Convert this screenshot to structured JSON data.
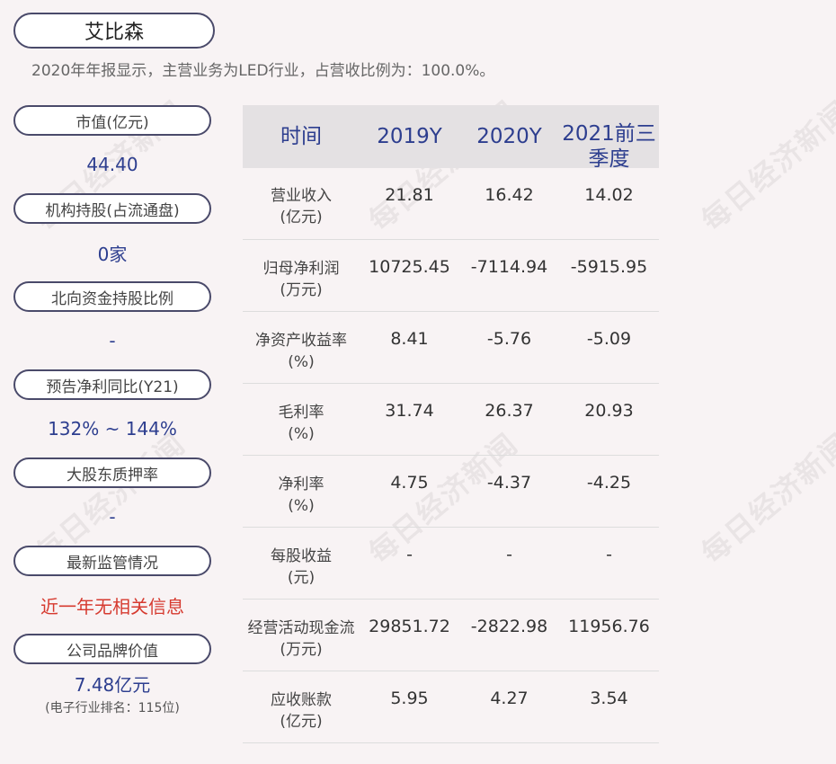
{
  "company": {
    "name": "艾比森"
  },
  "summary": "2020年年报显示，主营业务为LED行业，占营收比例为：100.0%。",
  "watermark": "每日经济新闻",
  "metrics": [
    {
      "label": "市值(亿元)",
      "value": "44.40"
    },
    {
      "label": "机构持股(占流通盘)",
      "value": "0家"
    },
    {
      "label": "北向资金持股比例",
      "value": "-"
    },
    {
      "label": "预告净利同比(Y21)",
      "value": "132% ~ 144%"
    },
    {
      "label": "大股东质押率",
      "value": "-"
    },
    {
      "label": "最新监管情况",
      "value": "近一年无相关信息",
      "color": "#d63a2f"
    },
    {
      "label": "公司品牌价值",
      "value": "7.48亿元",
      "note": "(电子行业排名：115位)"
    }
  ],
  "table": {
    "headers": [
      "时间",
      "2019Y",
      "2020Y",
      "2021前三季度"
    ],
    "rows": [
      {
        "label": "营业收入(亿元)",
        "label_lines": [
          "营业收入",
          "(亿元)"
        ],
        "values": [
          "21.81",
          "16.42",
          "14.02"
        ]
      },
      {
        "label": "归母净利润(万元)",
        "label_lines": [
          "归母净利润",
          "(万元)"
        ],
        "values": [
          "10725.45",
          "-7114.94",
          "-5915.95"
        ]
      },
      {
        "label": "净资产收益率(%)",
        "label_lines": [
          "净资产收益率",
          "(%)"
        ],
        "values": [
          "8.41",
          "-5.76",
          "-5.09"
        ]
      },
      {
        "label": "毛利率(%)",
        "label_lines": [
          "毛利率",
          "(%)"
        ],
        "values": [
          "31.74",
          "26.37",
          "20.93"
        ]
      },
      {
        "label": "净利率(%)",
        "label_lines": [
          "净利率",
          "(%)"
        ],
        "values": [
          "4.75",
          "-4.37",
          "-4.25"
        ]
      },
      {
        "label": "每股收益(元)",
        "label_lines": [
          "每股收益",
          "(元)"
        ],
        "values": [
          "-",
          "-",
          "-"
        ]
      },
      {
        "label": "经营活动现金流(万元)",
        "label_lines": [
          "经营活动现金流",
          "(万元)"
        ],
        "values": [
          "29851.72",
          "-2822.98",
          "11956.76"
        ]
      },
      {
        "label": "应收账款(亿元)",
        "label_lines": [
          "应收账款",
          "(亿元)"
        ],
        "values": [
          "5.95",
          "4.27",
          "3.54"
        ]
      }
    ]
  }
}
